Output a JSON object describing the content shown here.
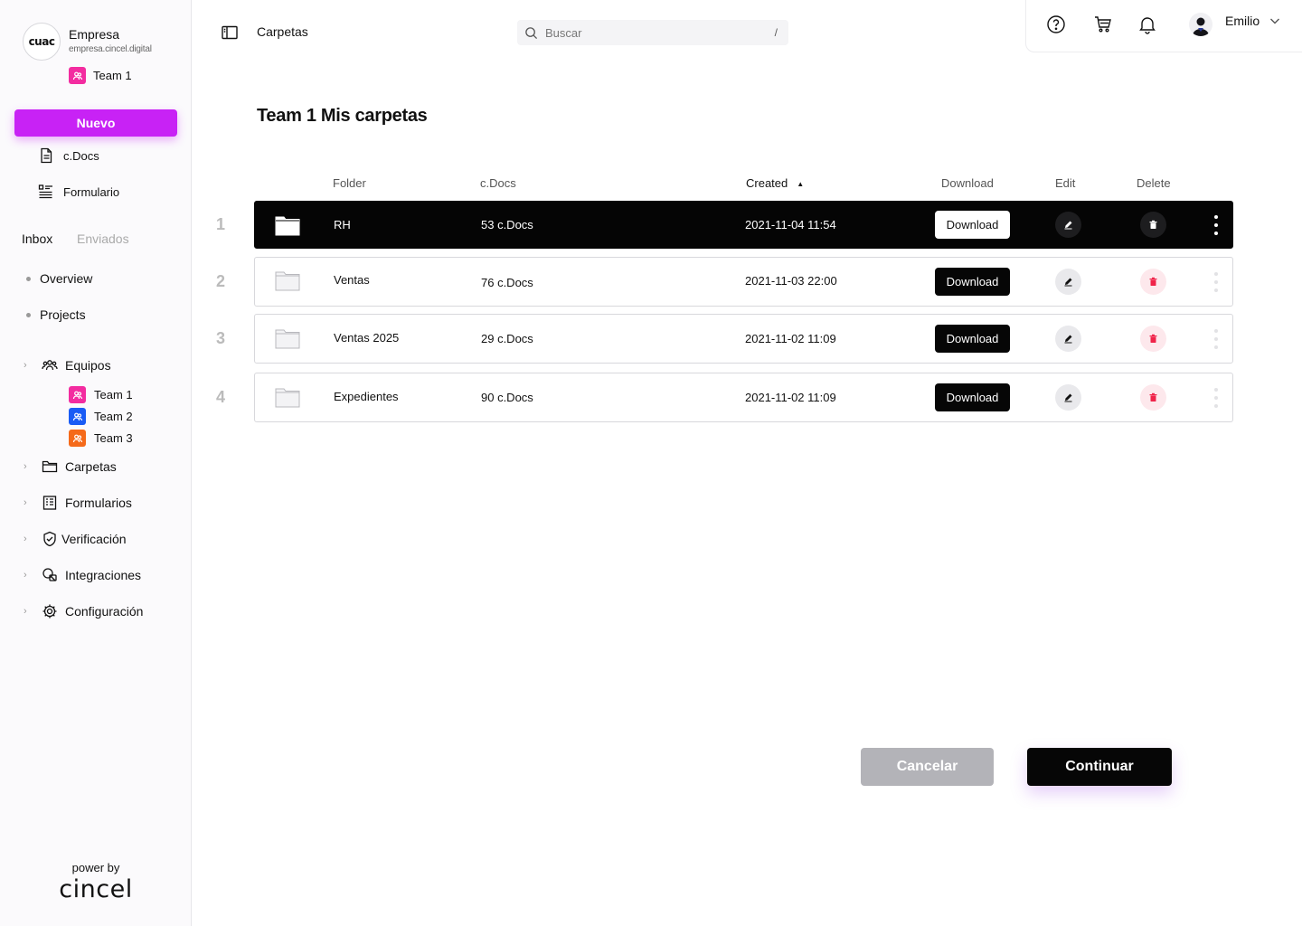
{
  "sidebar": {
    "logo_text": "cuac",
    "company_name": "Empresa",
    "company_domain": "empresa.cincel.digital",
    "current_team": "Team 1",
    "new_button": "Nuevo",
    "links": [
      {
        "label": "c.Docs",
        "icon": "document-icon"
      },
      {
        "label": "Formulario",
        "icon": "form-list-icon"
      }
    ],
    "tabs": {
      "inbox": "Inbox",
      "sent": "Enviados"
    },
    "dot_links": [
      {
        "label": "Overview"
      },
      {
        "label": "Projects"
      }
    ],
    "tree": [
      {
        "label": "Equipos",
        "icon": "team-icon"
      },
      {
        "label": "Carpetas",
        "icon": "folder-icon"
      },
      {
        "label": "Formularios",
        "icon": "forms-icon"
      },
      {
        "label": "Verificación",
        "icon": "shield-check-icon"
      },
      {
        "label": "Integraciones",
        "icon": "integrations-icon"
      },
      {
        "label": "Configuración",
        "icon": "gear-icon"
      }
    ],
    "teams": [
      {
        "label": "Team 1",
        "color": "#f32ca0"
      },
      {
        "label": "Team 2",
        "color": "#1a5cf5"
      },
      {
        "label": "Team 3",
        "color": "#f56a1a"
      }
    ],
    "powered_by": "power by",
    "brand": "cincel"
  },
  "header": {
    "breadcrumb": "Carpetas",
    "search_placeholder": "Buscar",
    "search_shortcut": "/",
    "user_name": "Emilio"
  },
  "main": {
    "title": "Team 1  Mis carpetas",
    "columns": {
      "folder": "Folder",
      "cdocs": "c.Docs",
      "created": "Created",
      "download": "Download",
      "edit": "Edit",
      "delete": "Delete"
    },
    "rows": [
      {
        "num": "1",
        "name": "RH",
        "cdocs": "53  c.Docs",
        "created": "2021-11-04   11:54",
        "download": "Download",
        "active": true
      },
      {
        "num": "2",
        "name": "Ventas",
        "cdocs": "76  c.Docs",
        "created": "2021-11-03   22:00",
        "download": "Download",
        "active": false
      },
      {
        "num": "3",
        "name": "Ventas  2025",
        "cdocs": "29  c.Docs",
        "created": "2021-11-02   11:09",
        "download": "Download",
        "active": false
      },
      {
        "num": "4",
        "name": "Expedientes",
        "cdocs": "90 c.Docs",
        "created": "2021-11-02   11:09",
        "download": "Download",
        "active": false
      }
    ],
    "cancel_button": "Cancelar",
    "continue_button": "Continuar"
  },
  "colors": {
    "accent": "#c822f5",
    "delete_red": "#f0244a",
    "dark": "#060606"
  }
}
